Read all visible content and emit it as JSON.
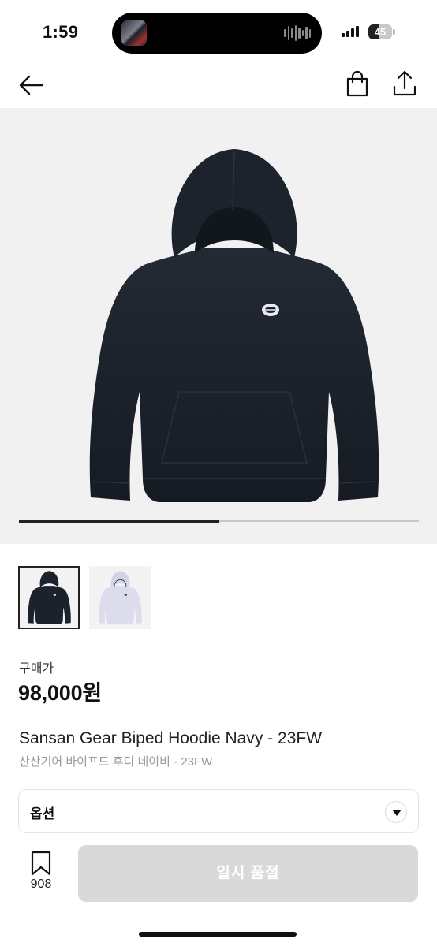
{
  "status_bar": {
    "time": "1:59",
    "battery_level": "45",
    "battery_fraction": 0.45
  },
  "nav": {
    "back_icon": "arrow-left-icon",
    "bag_icon": "shopping-bag-icon",
    "share_icon": "share-icon"
  },
  "gallery": {
    "image_count": 2,
    "current_index": 1,
    "progress_fraction": 0.5,
    "thumbnails": [
      {
        "variant": "navy",
        "color": "#1c222c",
        "selected": true
      },
      {
        "variant": "lavender",
        "color": "#dcdcec",
        "selected": false
      }
    ]
  },
  "product": {
    "price_label": "구매가",
    "price": "98,000원",
    "name_en": "Sansan Gear Biped Hoodie Navy - 23FW",
    "name_ko": "산산기어 바이프드 후디 네이비 - 23FW"
  },
  "options": {
    "label": "옵션",
    "toggle_icon": "caret-down-icon"
  },
  "bottom_bar": {
    "bookmark_icon": "bookmark-icon",
    "bookmark_count": "908",
    "cta_label": "일시 품절"
  },
  "colors": {
    "hoodie_navy": "#1c222c",
    "hero_background": "#f1f1f1",
    "disabled_button": "#d9d9d9",
    "secondary_text": "#999999"
  }
}
